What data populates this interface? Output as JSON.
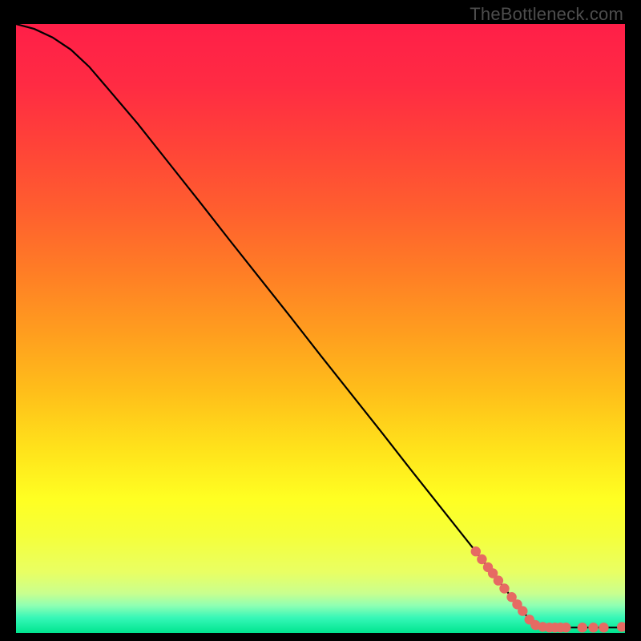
{
  "watermark": "TheBottleneck.com",
  "gradient_stops": [
    {
      "offset": 0.0,
      "color": "#ff1f48"
    },
    {
      "offset": 0.1,
      "color": "#ff2b43"
    },
    {
      "offset": 0.2,
      "color": "#ff4338"
    },
    {
      "offset": 0.3,
      "color": "#ff5d2f"
    },
    {
      "offset": 0.4,
      "color": "#ff7b26"
    },
    {
      "offset": 0.5,
      "color": "#ff9b1f"
    },
    {
      "offset": 0.6,
      "color": "#ffbd1a"
    },
    {
      "offset": 0.7,
      "color": "#ffe31b"
    },
    {
      "offset": 0.78,
      "color": "#ffff22"
    },
    {
      "offset": 0.84,
      "color": "#f5ff3a"
    },
    {
      "offset": 0.9,
      "color": "#e9ff63"
    },
    {
      "offset": 0.935,
      "color": "#c9ff8f"
    },
    {
      "offset": 0.955,
      "color": "#8fffb3"
    },
    {
      "offset": 0.975,
      "color": "#36f7b7"
    },
    {
      "offset": 1.0,
      "color": "#00e58f"
    }
  ],
  "chart_data": {
    "type": "line",
    "x_range": [
      0,
      100
    ],
    "y_range": [
      0,
      100
    ],
    "title": "",
    "xlabel": "",
    "ylabel": "",
    "series": [
      {
        "name": "curve",
        "points": [
          {
            "x": 0,
            "y": 100.0
          },
          {
            "x": 3,
            "y": 99.2
          },
          {
            "x": 6,
            "y": 97.8
          },
          {
            "x": 9,
            "y": 95.8
          },
          {
            "x": 12,
            "y": 93.0
          },
          {
            "x": 15,
            "y": 89.5
          },
          {
            "x": 20,
            "y": 83.6
          },
          {
            "x": 25,
            "y": 77.3
          },
          {
            "x": 30,
            "y": 71.0
          },
          {
            "x": 35,
            "y": 64.6
          },
          {
            "x": 40,
            "y": 58.3
          },
          {
            "x": 45,
            "y": 52.0
          },
          {
            "x": 50,
            "y": 45.6
          },
          {
            "x": 55,
            "y": 39.3
          },
          {
            "x": 60,
            "y": 33.0
          },
          {
            "x": 65,
            "y": 26.6
          },
          {
            "x": 70,
            "y": 20.3
          },
          {
            "x": 75,
            "y": 14.0
          },
          {
            "x": 80,
            "y": 7.6
          },
          {
            "x": 84,
            "y": 2.6
          },
          {
            "x": 86,
            "y": 1.3
          },
          {
            "x": 88,
            "y": 0.9
          },
          {
            "x": 90,
            "y": 0.9
          },
          {
            "x": 95,
            "y": 0.9
          },
          {
            "x": 100,
            "y": 0.9
          }
        ]
      },
      {
        "name": "dots",
        "points": [
          {
            "x": 75.5,
            "y": 13.4
          },
          {
            "x": 76.5,
            "y": 12.1
          },
          {
            "x": 77.5,
            "y": 10.8
          },
          {
            "x": 78.3,
            "y": 9.8
          },
          {
            "x": 79.2,
            "y": 8.6
          },
          {
            "x": 80.2,
            "y": 7.3
          },
          {
            "x": 81.4,
            "y": 5.9
          },
          {
            "x": 82.3,
            "y": 4.7
          },
          {
            "x": 83.2,
            "y": 3.6
          },
          {
            "x": 84.3,
            "y": 2.2
          },
          {
            "x": 85.3,
            "y": 1.3
          },
          {
            "x": 86.5,
            "y": 1.0
          },
          {
            "x": 87.6,
            "y": 0.9
          },
          {
            "x": 88.5,
            "y": 0.9
          },
          {
            "x": 89.4,
            "y": 0.9
          },
          {
            "x": 90.3,
            "y": 0.9
          },
          {
            "x": 93.0,
            "y": 0.9
          },
          {
            "x": 94.8,
            "y": 0.9
          },
          {
            "x": 96.5,
            "y": 0.9
          },
          {
            "x": 99.5,
            "y": 1.0
          }
        ]
      }
    ]
  }
}
